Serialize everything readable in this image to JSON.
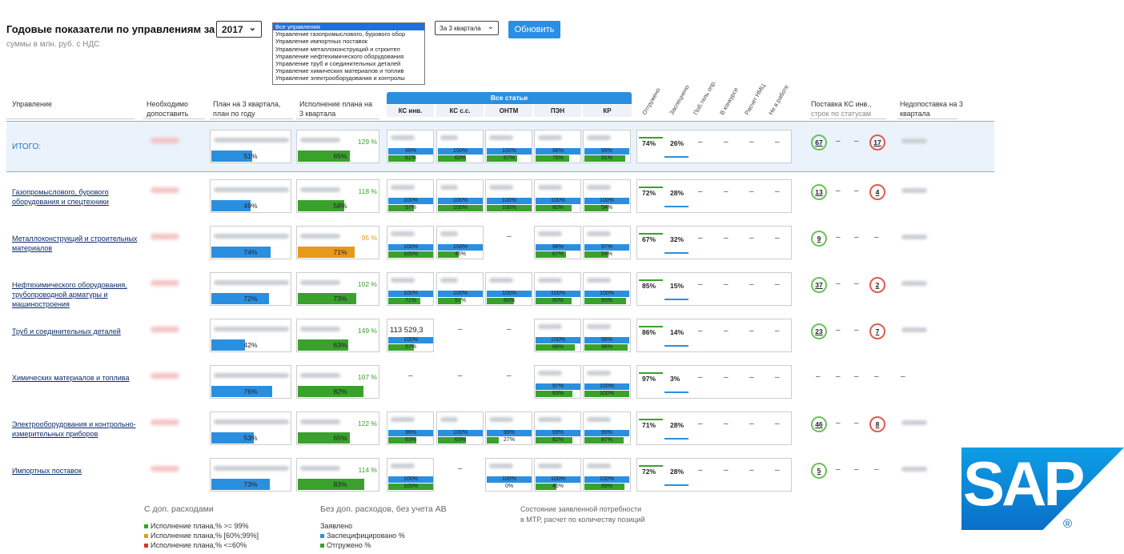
{
  "header": {
    "title": "Годовые показатели по управлениям за",
    "subtitle": "суммы в млн. руб. с НДС",
    "year": "2017",
    "quarter": "За 3 квартала",
    "refresh_label": "Обновить"
  },
  "department_list": [
    "Все управления",
    "Управление газопромыслового, бурового обор",
    "Управление импортных поставок",
    "Управление металлоконструкций и строител",
    "Управление нефтехимического оборудования",
    "Управление труб и соединительных деталей",
    "Управление химических материалов и топлив",
    "Управление электрооборудования и контролы"
  ],
  "columns": {
    "department": "Управление",
    "needed": "Необходимо допоставить",
    "plan": "План на 3 квартала, план по году",
    "execution": "Исполнение плана на 3 квартала",
    "all_articles": "Все статьи",
    "articles": [
      "КС инв.",
      "КС с.с.",
      "ОНТМ",
      "ПЭН",
      "КР"
    ],
    "statuses": [
      "Отгружено",
      "Заспецнено",
      "Поб.тель опр.",
      "В конкурсе",
      "Расчет НМЦ",
      "Не в работе"
    ],
    "ks_status": "Поставка КС инв.,",
    "ks_status_sub": "строк по статусам",
    "shortfall": "Недопоставка на 3 квартала"
  },
  "rows": [
    {
      "name": "ИТОГО:",
      "plan_pct": "51%",
      "plan_frac": 0.51,
      "exec_pct_text": "129 %",
      "exec_bar": "65%",
      "exec_frac": 0.65,
      "exec_color": "green",
      "articles": [
        [
          "99%",
          "61%"
        ],
        [
          "100%",
          "63%"
        ],
        [
          "100%",
          "67%"
        ],
        [
          "98%",
          "75%"
        ],
        [
          "99%",
          "91%"
        ]
      ],
      "shipped": "74%",
      "spec": "26%",
      "circles": [
        "67",
        "–",
        "–",
        "17"
      ]
    },
    {
      "name": "Газопромыслового, бурового оборудования и спецтехники",
      "plan_pct": "49%",
      "plan_frac": 0.49,
      "exec_pct_text": "118 %",
      "exec_bar": "58%",
      "exec_frac": 0.58,
      "exec_color": "green",
      "articles": [
        [
          "100%",
          "57%"
        ],
        [
          "100%",
          "100%"
        ],
        [
          "100%",
          "100%"
        ],
        [
          "100%",
          "80%"
        ],
        [
          "100%",
          "54%"
        ]
      ],
      "shipped": "72%",
      "spec": "28%",
      "circles": [
        "13",
        "–",
        "–",
        "4"
      ]
    },
    {
      "name": "Металлоконструкций и строительных материалов",
      "plan_pct": "74%",
      "plan_frac": 0.74,
      "exec_pct_text": "95 %",
      "exec_bar": "71%",
      "exec_frac": 0.71,
      "exec_color": "orange",
      "articles": [
        [
          "100%",
          "100%"
        ],
        [
          "100%",
          "46%"
        ],
        null,
        [
          "98%",
          "67%"
        ],
        [
          "97%",
          "54%"
        ]
      ],
      "shipped": "67%",
      "spec": "32%",
      "circles": [
        "9",
        "–",
        "–",
        "–"
      ]
    },
    {
      "name": "Нефтехимического оборудования, трубопроводной арматуры и машиностроения",
      "plan_pct": "72%",
      "plan_frac": 0.72,
      "exec_pct_text": "102 %",
      "exec_bar": "73%",
      "exec_frac": 0.73,
      "exec_color": "green",
      "articles": [
        [
          "100%",
          "71%"
        ],
        [
          "100%",
          "51%"
        ],
        [
          "100%",
          "60%"
        ],
        [
          "100%",
          "80%"
        ],
        [
          "100%",
          "93%"
        ]
      ],
      "shipped": "85%",
      "spec": "15%",
      "circles": [
        "37",
        "–",
        "–",
        "2"
      ]
    },
    {
      "name": "Труб и соединительных деталей",
      "plan_pct": "42%",
      "plan_frac": 0.42,
      "exec_pct_text": "149 %",
      "exec_bar": "63%",
      "exec_frac": 0.63,
      "exec_color": "green",
      "ks_value": "113 529,3",
      "articles": [
        [
          "100%",
          "57%"
        ],
        null,
        null,
        [
          "100%",
          "88%"
        ],
        [
          "99%",
          "96%"
        ]
      ],
      "shipped": "86%",
      "spec": "14%",
      "circles": [
        "23",
        "–",
        "–",
        "7"
      ]
    },
    {
      "name": "Химических материалов и топлива",
      "plan_pct": "76%",
      "plan_frac": 0.76,
      "exec_pct_text": "107 %",
      "exec_bar": "82%",
      "exec_frac": 0.82,
      "exec_color": "green",
      "articles": [
        null,
        null,
        null,
        [
          "97%",
          "83%"
        ],
        [
          "100%",
          "100%"
        ]
      ],
      "shipped": "97%",
      "spec": "3%",
      "circles": [
        "–",
        "–",
        "–",
        "–"
      ]
    },
    {
      "name": "Электрооборудования и контрольно-измерительных приборов",
      "plan_pct": "53%",
      "plan_frac": 0.53,
      "exec_pct_text": "122 %",
      "exec_bar": "65%",
      "exec_frac": 0.65,
      "exec_color": "green",
      "articles": [
        [
          "96%",
          "63%"
        ],
        [
          "100%",
          "63%"
        ],
        [
          "99%",
          "27%"
        ],
        [
          "99%",
          "82%"
        ],
        [
          "99%",
          "87%"
        ]
      ],
      "shipped": "71%",
      "spec": "28%",
      "circles": [
        "46",
        "–",
        "–",
        "8"
      ]
    },
    {
      "name": "Импортных поставок",
      "plan_pct": "73%",
      "plan_frac": 0.73,
      "exec_pct_text": "114 %",
      "exec_bar": "83%",
      "exec_frac": 0.83,
      "exec_color": "green",
      "articles": [
        [
          "100%",
          "100%"
        ],
        null,
        [
          "100%",
          "0%"
        ],
        [
          "100%",
          "46%"
        ],
        [
          "100%",
          "89%"
        ]
      ],
      "shipped": "72%",
      "spec": "28%",
      "circles": [
        "5",
        "–",
        "–",
        "–"
      ]
    }
  ],
  "legend": {
    "a_title": "С доп. расходами",
    "a_items": [
      "Исполнение плана,% >= 99%",
      "Исполнение плана,% [60%;99%]",
      "Исполнение плана,% <=60%"
    ],
    "b_title": "Без доп. расходов, без учета АВ",
    "b_sub": "Заявлено",
    "b_items": [
      "Заспецифицировано %",
      "Отгружено %"
    ],
    "c_text1": "Состояние заявленной потребности",
    "c_text2": "в МТР, расчет по количеству позиций"
  },
  "logo": {
    "text": "SAP",
    "reg": "®"
  },
  "colors": {
    "blue": "#2b8fe0",
    "green": "#3aa12d",
    "orange": "#e69a1b",
    "red": "#d9342b"
  }
}
